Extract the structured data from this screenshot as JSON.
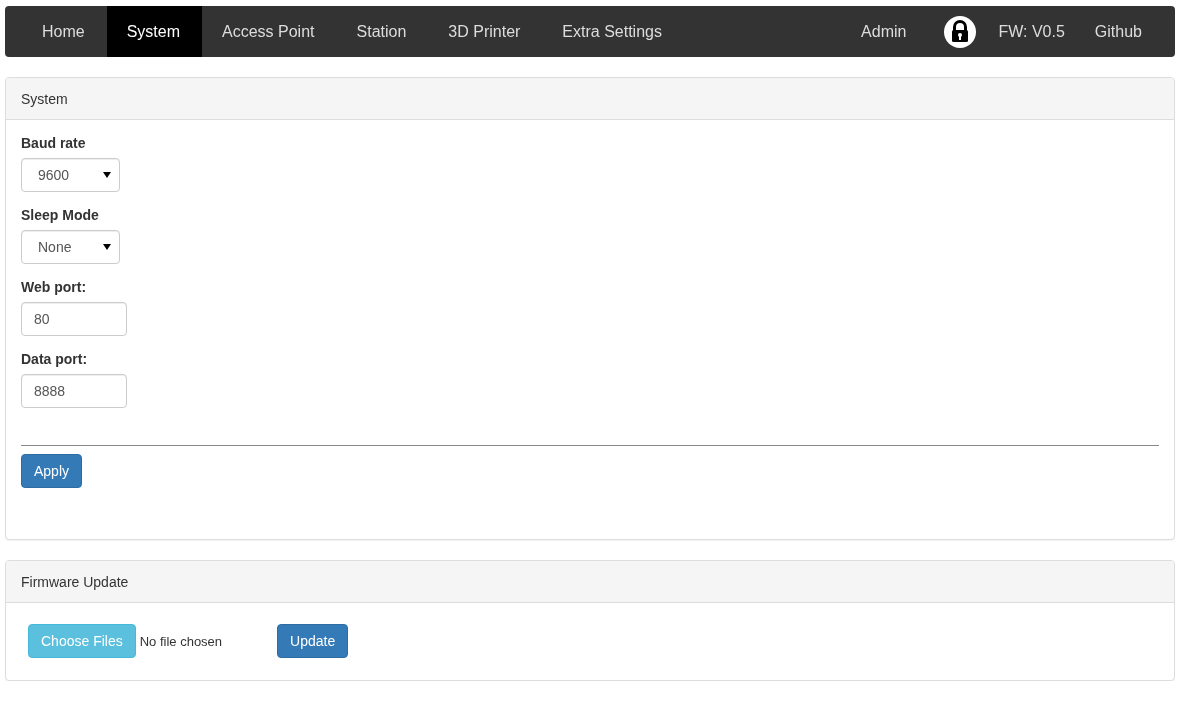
{
  "navbar": {
    "items": [
      {
        "label": "Home",
        "selected": false
      },
      {
        "label": "System",
        "selected": true
      },
      {
        "label": "Access Point",
        "selected": false
      },
      {
        "label": "Station",
        "selected": false
      },
      {
        "label": "3D Printer",
        "selected": false
      },
      {
        "label": "Extra Settings",
        "selected": false
      }
    ],
    "right_items": [
      {
        "kind": "link",
        "label": "Admin"
      },
      {
        "kind": "lock"
      },
      {
        "kind": "link",
        "label": "FW: V0.5"
      },
      {
        "kind": "link",
        "label": "Github"
      }
    ]
  },
  "system_panel": {
    "title": "System",
    "fields": [
      {
        "kind": "select",
        "label": "Baud rate",
        "value": "9600"
      },
      {
        "kind": "select",
        "label": "Sleep Mode",
        "value": "None"
      },
      {
        "kind": "input",
        "label": "Web port:",
        "value": "80"
      },
      {
        "kind": "input",
        "label": "Data port:",
        "value": "8888"
      }
    ],
    "apply_button": "Apply"
  },
  "firmware_panel": {
    "title": "Firmware Update",
    "choose_button": "Choose Files",
    "file_status": "No file chosen",
    "update_button": "Update"
  }
}
